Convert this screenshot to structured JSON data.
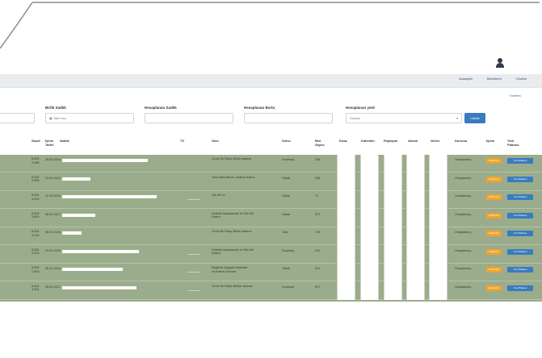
{
  "navbar": {
    "links": [
      "Anasayfa",
      "Birimlerim",
      "Yönetici"
    ]
  },
  "subnote": "Yönetim",
  "filters": {
    "labels": [
      "Birlik Sadlık",
      "Hesaplanan Sadlık",
      "Hesaplanan Borlu",
      "Hesaplanan yetd"
    ],
    "input_values": [
      "",
      "Tarih seç",
      "",
      "",
      "Seçiniz"
    ],
    "button": "Listele"
  },
  "table": {
    "headers": [
      "Sacdi",
      "İşlem\nTarihi",
      "Sadlık",
      "TC",
      "Ünvı",
      "Sınıvı",
      "Bizi\nSayısı",
      "Kiraz",
      "Kalemler",
      "Paylaşım",
      "Alınan",
      "Gelen",
      "Durumu",
      "İşlem",
      "Yeni\nPlatosu"
    ],
    "rows": [
      {
        "id": "8.525\n2.098",
        "date": "28.03.2019",
        "bar": 0.78,
        "tc": "",
        "desc": "Ovulo İlk Satışı Birimi sadece",
        "kind": "Ovulmaş",
        "qty": "246",
        "status": "Onaylanmış"
      },
      {
        "id": "8.525\n2.596",
        "date": "02.04.2019",
        "bar": 0.26,
        "tc": "",
        "desc": "Yeni Satış Birimi, sadece Kalem",
        "kind": "Sıklalı",
        "qty": "238",
        "status": "Onaylanmış"
      },
      {
        "id": "8.526\n3.025",
        "date": "11.03.2019",
        "bar": 0.86,
        "tc": "—————",
        "desc": "Sıkı İlk Le",
        "kind": "Sıklalı",
        "qty": "72",
        "status": "Onaylanmış"
      },
      {
        "id": "8.525\n2.800",
        "date": "28.02.2017",
        "bar": 0.3,
        "tc": "",
        "desc": "Ünitede kalanlardan ve Sıkı Bir\nKalem",
        "kind": "Sıklalı",
        "qty": "207",
        "status": "Onaylanmış"
      },
      {
        "id": "8.425\n3.100",
        "date": "08.02.2019",
        "bar": 0.18,
        "tc": "",
        "desc": "Ovulo İlk Satışı Birimi sadece",
        "kind": "Tarlu",
        "qty": "176",
        "status": "Onaylanmış"
      },
      {
        "id": "8.525\n3.023",
        "date": "24.01.2018",
        "bar": 0.7,
        "tc": "—————",
        "desc": "Ünitede kalanlardan ve Sıkı Bir\nKalem",
        "kind": "Ovulmaş",
        "qty": "232",
        "status": "Onaylanmış"
      },
      {
        "id": "8.525\n2.843",
        "date": "28.12.2018",
        "bar": 0.55,
        "tc": "—————",
        "desc": "Bağlantı Üçayak Kalemleri\nve Kalem Ovolum",
        "kind": "Tarlalı",
        "qty": "261",
        "status": "Onaylanmış"
      },
      {
        "id": "8.401\n3.061",
        "date": "28.01.2017",
        "bar": 0.68,
        "tc": "—————",
        "desc": "Ovulo İlk Satışı Bölüm sadece",
        "kind": "Ovulmaş",
        "qty": "207",
        "status": "Onaylanmış"
      }
    ],
    "action_labels": {
      "edit": "Görünüm",
      "platform": "Yeni Platosu"
    }
  }
}
